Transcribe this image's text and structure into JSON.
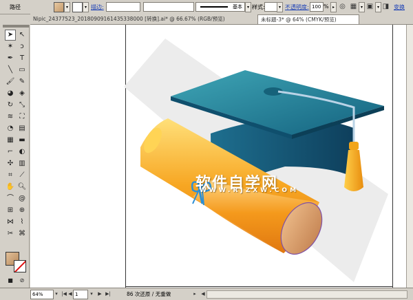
{
  "control_bar": {
    "path_label": "路径",
    "align_label": "描边:",
    "stroke_style_label": "基本",
    "style_label": "样式:",
    "opacity_label": "不透明度:",
    "opacity_value": "100",
    "opacity_unit": "%",
    "transform_label": "变换"
  },
  "tabs": [
    {
      "label": "Nipic_24377523_20180909161435338000 [转换].ai* @ 66.67% (RGB/预览)"
    },
    {
      "label": "未标题-3* @ 64% (CMYK/预览)"
    }
  ],
  "canvas": {
    "watermark": "软件自学网",
    "watermark_sub": "WWW.RJZXW.COM"
  },
  "status_bar": {
    "zoom_value": "64%",
    "artboard_value": "1",
    "undo_status": "86 次还原 / 无重做"
  },
  "colors": {
    "cap": "#1e7f98",
    "cap_dark": "#0f4f6d",
    "tassel": "#f5a316",
    "scroll": "#f6a21a",
    "scroll_end": "#d9a070",
    "ribbon": "#2b8fd6",
    "shadow": "#e8e8e8"
  }
}
